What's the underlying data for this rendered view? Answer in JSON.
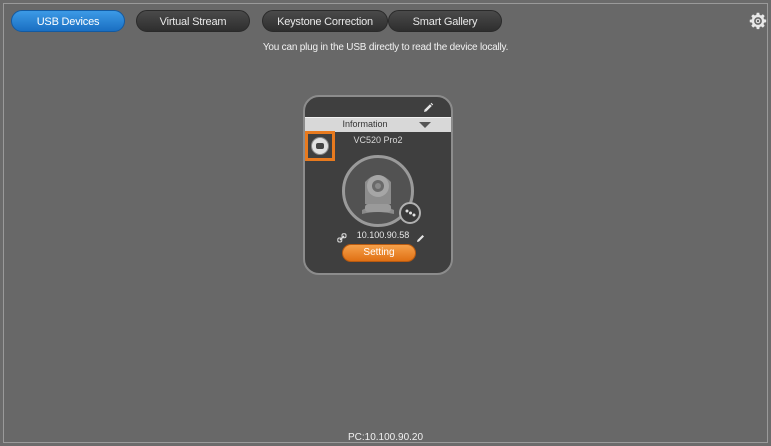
{
  "tabs": [
    {
      "label": "USB Devices",
      "active": true
    },
    {
      "label": "Virtual Stream",
      "active": false
    },
    {
      "label": "Keystone Correction",
      "active": false
    },
    {
      "label": "Smart Gallery",
      "active": false
    }
  ],
  "settings_icon": "gear-icon",
  "hint": "You can plug in the USB directly to read the device locally.",
  "device_card": {
    "info_label": "Information",
    "model": "VC520 Pro2",
    "ip": "10.100.90.58",
    "setting_label": "Setting",
    "icons": {
      "edit": "pencil-icon",
      "select": "camera-select-icon",
      "preview": "ptz-camera-icon",
      "zoom": "zoom-icon",
      "link": "link-icon"
    },
    "highlight_color": "#e87a1e",
    "button_color": "#f08c2e"
  },
  "footer": {
    "pc_address": "PC:10.100.90.20"
  },
  "colors": {
    "active_tab": "#2a84d8",
    "background": "#686868"
  }
}
